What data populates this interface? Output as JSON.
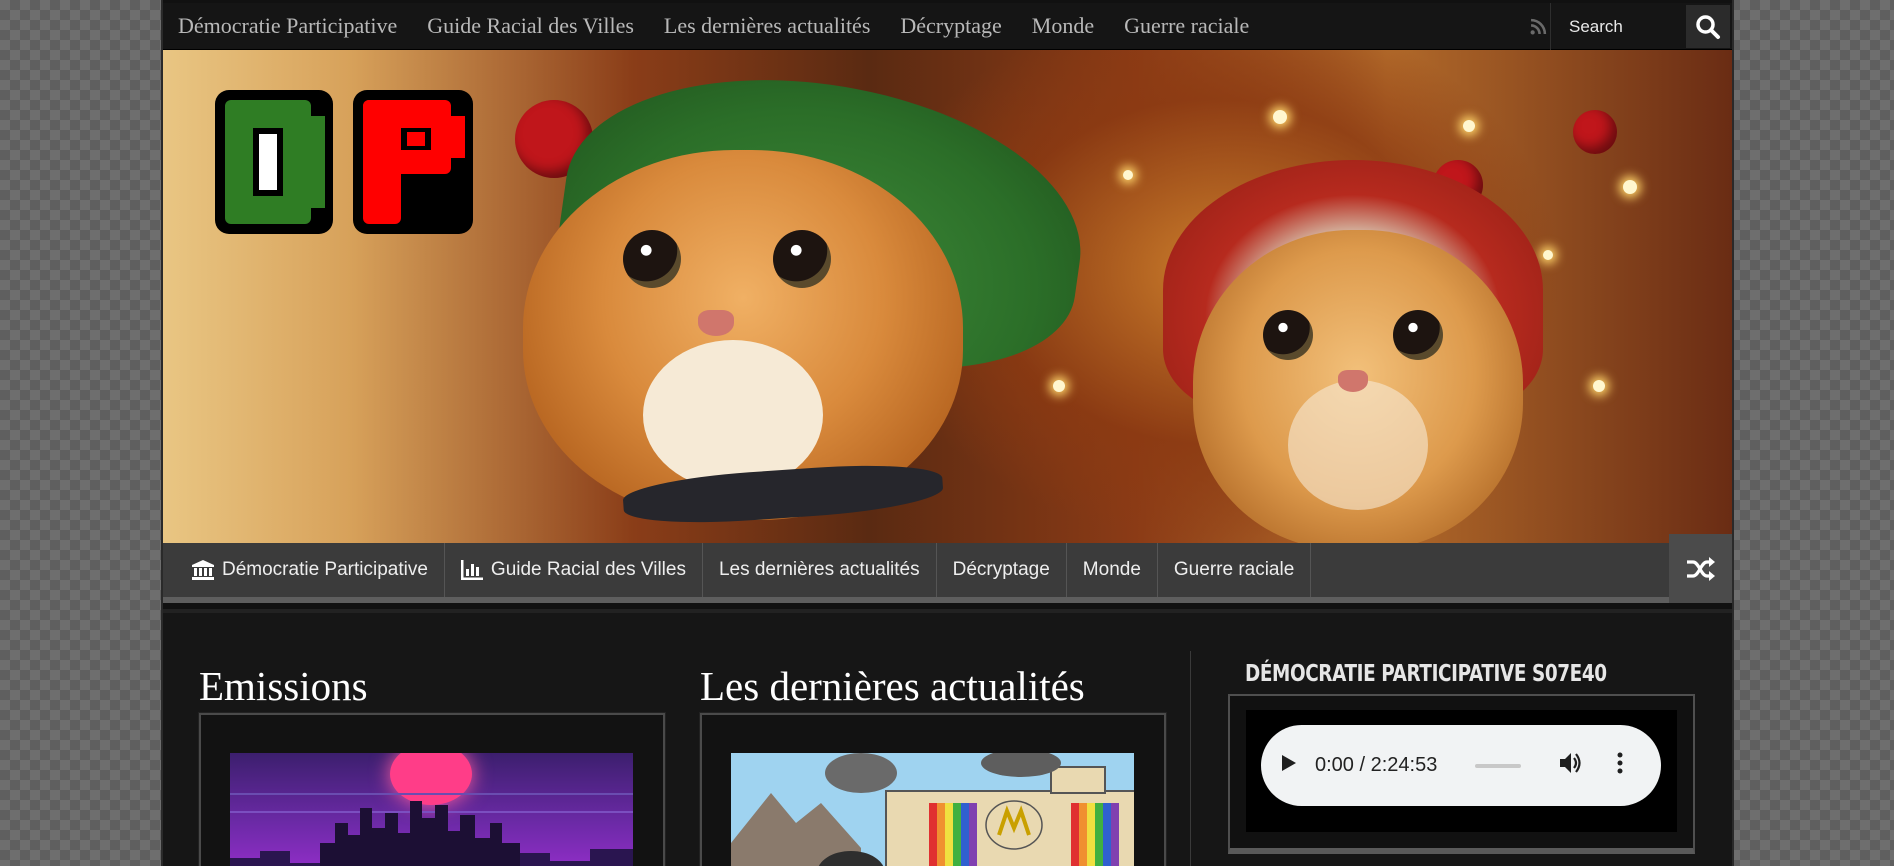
{
  "top_nav": {
    "items": [
      {
        "label": "Démocratie Participative"
      },
      {
        "label": "Guide Racial des Villes"
      },
      {
        "label": "Les dernières actualités"
      },
      {
        "label": "Décryptage"
      },
      {
        "label": "Monde"
      },
      {
        "label": "Guerre raciale"
      }
    ],
    "search_placeholder": "Search",
    "icons": [
      "rss-icon",
      "search-icon"
    ]
  },
  "banner": {
    "logo_text": "DP",
    "colors": {
      "d": "#2f7d24",
      "p": "#ff0000",
      "outline": "#000000"
    }
  },
  "main_nav": {
    "items": [
      {
        "label": "Démocratie Participative",
        "icon": "bank-icon"
      },
      {
        "label": "Guide Racial des Villes",
        "icon": "bar-chart-icon"
      },
      {
        "label": "Les dernières actualités"
      },
      {
        "label": "Décryptage"
      },
      {
        "label": "Monde"
      },
      {
        "label": "Guerre raciale"
      }
    ],
    "shuffle_icon": "shuffle-icon"
  },
  "sections": {
    "emissions_title": "Emissions",
    "latest_title": "Les dernières actualités"
  },
  "widget": {
    "title": "Démocratie Participative S07E40",
    "player": {
      "time": "0:00 / 2:24:53"
    }
  },
  "colors": {
    "background": "#111111",
    "nav_bg": "#3b3b3b",
    "topnav_bg": "#151515"
  }
}
